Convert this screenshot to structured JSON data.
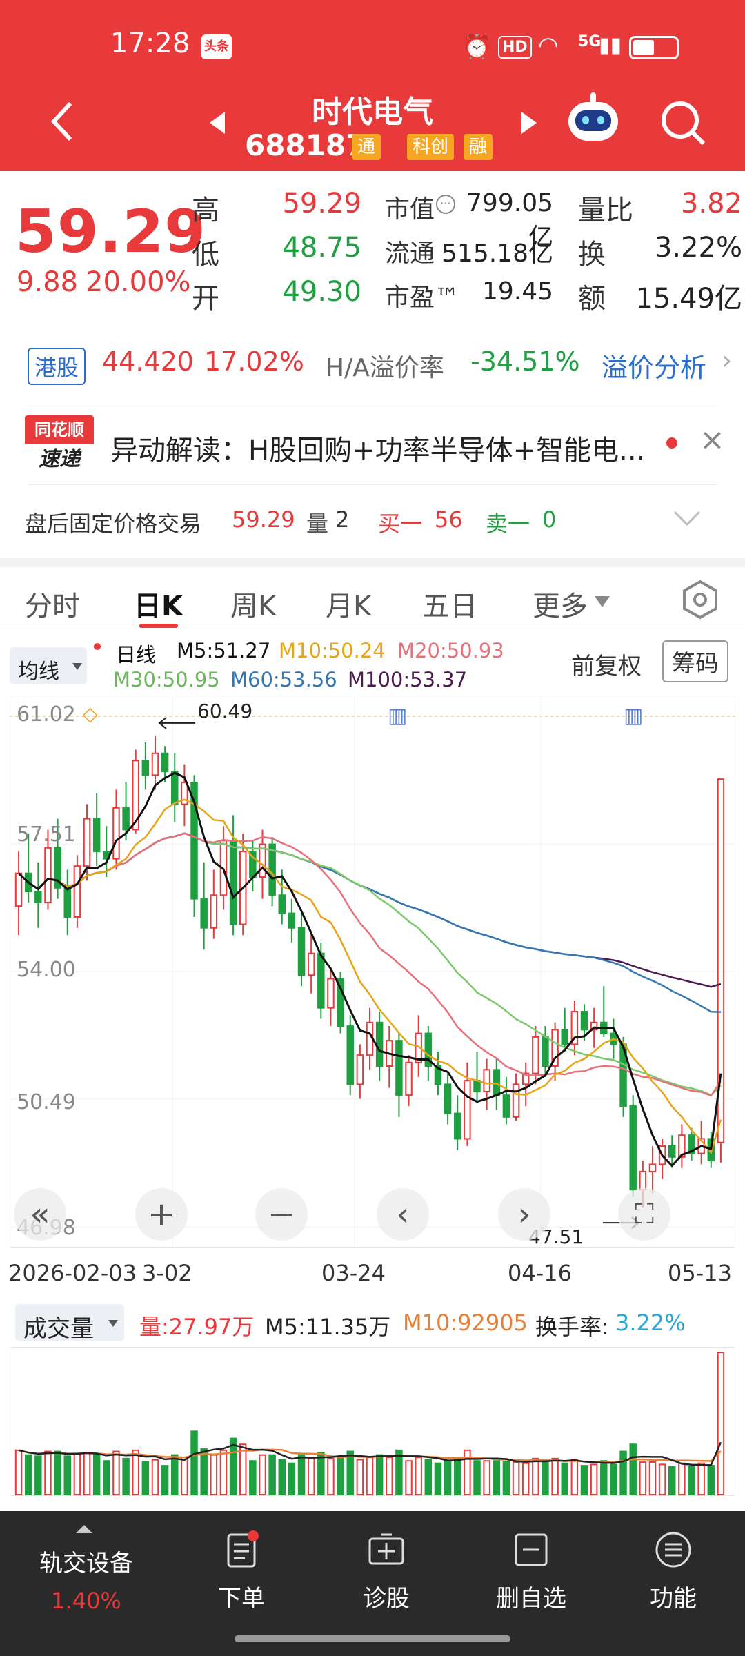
{
  "status_bar": {
    "time": "17:28",
    "app_badge": "头条",
    "hd": "HD",
    "network": "5G"
  },
  "header": {
    "title": "时代电气",
    "code": "688187",
    "tags": [
      "通",
      "科创",
      "融"
    ]
  },
  "quote": {
    "price": "59.29",
    "change": "9.88",
    "change_pct": "20.00%",
    "high_label": "高",
    "high": "59.29",
    "low_label": "低",
    "low": "48.75",
    "open_label": "开",
    "open": "49.30",
    "mktcap_label": "市值",
    "mktcap": "799.05亿",
    "float_label": "流通",
    "float": "515.18亿",
    "pe_label": "市盈™",
    "pe": "19.45",
    "volratio_label": "量比",
    "volratio": "3.82",
    "turnover_label": "换",
    "turnover": "3.22%",
    "amount_label": "额",
    "amount": "15.49亿"
  },
  "hk": {
    "badge": "港股",
    "price": "44.420",
    "pct": "17.02%",
    "premium_label": "H/A溢价率",
    "premium": "-34.51%",
    "analysis_link": "溢价分析"
  },
  "news": {
    "logo_top": "同花顺",
    "logo_bottom": "速递",
    "text": "异动解读：H股回购+功率半导体+智能电..."
  },
  "after_hours": {
    "label": "盘后固定价格交易",
    "price": "59.29",
    "vol_label": "量",
    "vol": "2",
    "buy_label": "买一",
    "buy": "56",
    "sell_label": "卖一",
    "sell": "0"
  },
  "tabs": [
    "分时",
    "日K",
    "周K",
    "月K",
    "五日",
    "更多"
  ],
  "ma_legend": {
    "selector": "均线",
    "period": "日线",
    "m5": "M5:51.27",
    "m10": "M10:50.24",
    "m20": "M20:50.93",
    "m30": "M30:50.95",
    "m60": "M60:53.56",
    "m100": "M100:53.37",
    "adjust": "前复权",
    "chips": "筹码"
  },
  "colors": {
    "red": "#e8393b",
    "green": "#1ea041",
    "m5": "#111111",
    "m10": "#e8a317",
    "m20": "#e8707a",
    "m30": "#7bc96b",
    "m60": "#3479b5",
    "m100": "#4b1a4f"
  },
  "chart_data": {
    "type": "candlestick",
    "y_ticks": [
      "61.02",
      "57.51",
      "54.00",
      "50.49",
      "46.98"
    ],
    "ylim": [
      46.98,
      61.02
    ],
    "x_ticks": [
      "2026-02-03",
      "3-02",
      "03-24",
      "04-16",
      "05-13"
    ],
    "annotations": {
      "high": "60.49",
      "low": "47.51"
    },
    "candles": [
      {
        "o": 55.8,
        "h": 57.3,
        "l": 55.0,
        "c": 56.7
      },
      {
        "o": 56.7,
        "h": 57.8,
        "l": 55.9,
        "c": 56.2
      },
      {
        "o": 56.2,
        "h": 57.0,
        "l": 55.2,
        "c": 55.9
      },
      {
        "o": 55.9,
        "h": 57.9,
        "l": 55.7,
        "c": 57.4
      },
      {
        "o": 57.4,
        "h": 58.2,
        "l": 56.0,
        "c": 56.3
      },
      {
        "o": 56.3,
        "h": 56.8,
        "l": 55.0,
        "c": 55.5
      },
      {
        "o": 55.5,
        "h": 57.2,
        "l": 55.2,
        "c": 56.9
      },
      {
        "o": 56.9,
        "h": 58.6,
        "l": 56.5,
        "c": 58.2
      },
      {
        "o": 58.2,
        "h": 58.9,
        "l": 56.9,
        "c": 57.3
      },
      {
        "o": 57.3,
        "h": 58.0,
        "l": 56.6,
        "c": 57.1
      },
      {
        "o": 57.1,
        "h": 59.0,
        "l": 56.8,
        "c": 58.5
      },
      {
        "o": 58.5,
        "h": 59.2,
        "l": 57.6,
        "c": 57.9
      },
      {
        "o": 57.9,
        "h": 60.1,
        "l": 57.8,
        "c": 59.8
      },
      {
        "o": 59.8,
        "h": 60.3,
        "l": 59.0,
        "c": 59.4
      },
      {
        "o": 59.4,
        "h": 60.49,
        "l": 59.0,
        "c": 60.0
      },
      {
        "o": 60.0,
        "h": 60.2,
        "l": 59.2,
        "c": 59.5
      },
      {
        "o": 59.5,
        "h": 60.0,
        "l": 58.1,
        "c": 58.6
      },
      {
        "o": 58.6,
        "h": 59.7,
        "l": 58.0,
        "c": 59.2
      },
      {
        "o": 59.2,
        "h": 59.4,
        "l": 55.5,
        "c": 56.0
      },
      {
        "o": 56.0,
        "h": 57.0,
        "l": 54.6,
        "c": 55.2
      },
      {
        "o": 55.2,
        "h": 56.8,
        "l": 54.9,
        "c": 56.1
      },
      {
        "o": 56.1,
        "h": 58.0,
        "l": 55.7,
        "c": 57.6
      },
      {
        "o": 57.6,
        "h": 58.3,
        "l": 55.0,
        "c": 55.3
      },
      {
        "o": 55.3,
        "h": 57.8,
        "l": 55.0,
        "c": 57.3
      },
      {
        "o": 57.3,
        "h": 57.6,
        "l": 56.2,
        "c": 56.6
      },
      {
        "o": 56.6,
        "h": 57.9,
        "l": 56.0,
        "c": 57.5
      },
      {
        "o": 57.5,
        "h": 57.7,
        "l": 55.8,
        "c": 56.1
      },
      {
        "o": 56.1,
        "h": 56.8,
        "l": 55.3,
        "c": 55.6
      },
      {
        "o": 55.6,
        "h": 56.0,
        "l": 54.8,
        "c": 55.2
      },
      {
        "o": 55.2,
        "h": 55.6,
        "l": 53.6,
        "c": 53.9
      },
      {
        "o": 53.9,
        "h": 55.1,
        "l": 53.4,
        "c": 54.5
      },
      {
        "o": 54.5,
        "h": 54.8,
        "l": 52.7,
        "c": 53.0
      },
      {
        "o": 53.0,
        "h": 54.1,
        "l": 52.5,
        "c": 53.8
      },
      {
        "o": 53.8,
        "h": 54.0,
        "l": 52.3,
        "c": 52.5
      },
      {
        "o": 52.5,
        "h": 52.8,
        "l": 50.6,
        "c": 50.9
      },
      {
        "o": 50.9,
        "h": 52.0,
        "l": 50.5,
        "c": 51.7
      },
      {
        "o": 51.7,
        "h": 53.0,
        "l": 51.3,
        "c": 52.6
      },
      {
        "o": 52.6,
        "h": 52.9,
        "l": 51.0,
        "c": 51.4
      },
      {
        "o": 51.4,
        "h": 52.5,
        "l": 50.8,
        "c": 52.1
      },
      {
        "o": 52.1,
        "h": 52.3,
        "l": 50.0,
        "c": 50.6
      },
      {
        "o": 50.6,
        "h": 51.7,
        "l": 50.3,
        "c": 51.5
      },
      {
        "o": 51.5,
        "h": 52.8,
        "l": 51.1,
        "c": 52.3
      },
      {
        "o": 52.3,
        "h": 52.5,
        "l": 51.0,
        "c": 51.4
      },
      {
        "o": 51.4,
        "h": 51.8,
        "l": 50.6,
        "c": 50.9
      },
      {
        "o": 50.9,
        "h": 51.2,
        "l": 49.8,
        "c": 50.1
      },
      {
        "o": 50.1,
        "h": 50.6,
        "l": 49.1,
        "c": 49.4
      },
      {
        "o": 49.4,
        "h": 51.5,
        "l": 49.2,
        "c": 51.0
      },
      {
        "o": 51.0,
        "h": 51.8,
        "l": 50.4,
        "c": 50.7
      },
      {
        "o": 50.7,
        "h": 51.6,
        "l": 50.2,
        "c": 51.3
      },
      {
        "o": 51.3,
        "h": 51.6,
        "l": 50.2,
        "c": 50.6
      },
      {
        "o": 50.6,
        "h": 51.1,
        "l": 49.8,
        "c": 50.0
      },
      {
        "o": 50.0,
        "h": 51.2,
        "l": 49.9,
        "c": 50.9
      },
      {
        "o": 50.9,
        "h": 51.5,
        "l": 50.3,
        "c": 51.2
      },
      {
        "o": 51.2,
        "h": 52.5,
        "l": 50.9,
        "c": 52.2
      },
      {
        "o": 52.2,
        "h": 52.5,
        "l": 51.1,
        "c": 51.4
      },
      {
        "o": 51.4,
        "h": 52.6,
        "l": 51.0,
        "c": 52.4
      },
      {
        "o": 52.4,
        "h": 53.0,
        "l": 51.8,
        "c": 52.0
      },
      {
        "o": 52.0,
        "h": 53.2,
        "l": 51.7,
        "c": 52.9
      },
      {
        "o": 52.9,
        "h": 53.1,
        "l": 52.1,
        "c": 52.4
      },
      {
        "o": 52.4,
        "h": 53.0,
        "l": 51.9,
        "c": 52.6
      },
      {
        "o": 52.6,
        "h": 53.6,
        "l": 52.2,
        "c": 52.3
      },
      {
        "o": 52.3,
        "h": 52.7,
        "l": 51.6,
        "c": 52.0
      },
      {
        "o": 52.0,
        "h": 52.2,
        "l": 50.0,
        "c": 50.3
      },
      {
        "o": 50.3,
        "h": 50.6,
        "l": 47.8,
        "c": 48.0
      },
      {
        "o": 48.0,
        "h": 48.8,
        "l": 47.51,
        "c": 48.5
      },
      {
        "o": 48.5,
        "h": 49.2,
        "l": 47.9,
        "c": 48.7
      },
      {
        "o": 48.7,
        "h": 49.4,
        "l": 48.3,
        "c": 49.2
      },
      {
        "o": 49.2,
        "h": 49.5,
        "l": 48.6,
        "c": 48.9
      },
      {
        "o": 48.9,
        "h": 49.8,
        "l": 48.6,
        "c": 49.5
      },
      {
        "o": 49.5,
        "h": 49.7,
        "l": 48.8,
        "c": 49.0
      },
      {
        "o": 49.0,
        "h": 49.9,
        "l": 48.7,
        "c": 49.4
      },
      {
        "o": 49.4,
        "h": 49.6,
        "l": 48.6,
        "c": 48.8
      },
      {
        "o": 49.3,
        "h": 59.29,
        "l": 48.75,
        "c": 59.29
      }
    ]
  },
  "controls": [
    "«",
    "+",
    "−",
    "‹",
    "›",
    "⛶"
  ],
  "volume": {
    "selector": "成交量",
    "vol": "量:27.97万",
    "m5": "M5:11.35万",
    "m10": "M10:92905",
    "turnover_label": "换手率:",
    "turnover": "3.22%"
  },
  "bottom_tabs": {
    "ticker_name": "轨交设备",
    "ticker_pct": "1.40%",
    "order": "下单",
    "diagnose": "诊股",
    "remove_watch": "删自选",
    "functions": "功能"
  }
}
